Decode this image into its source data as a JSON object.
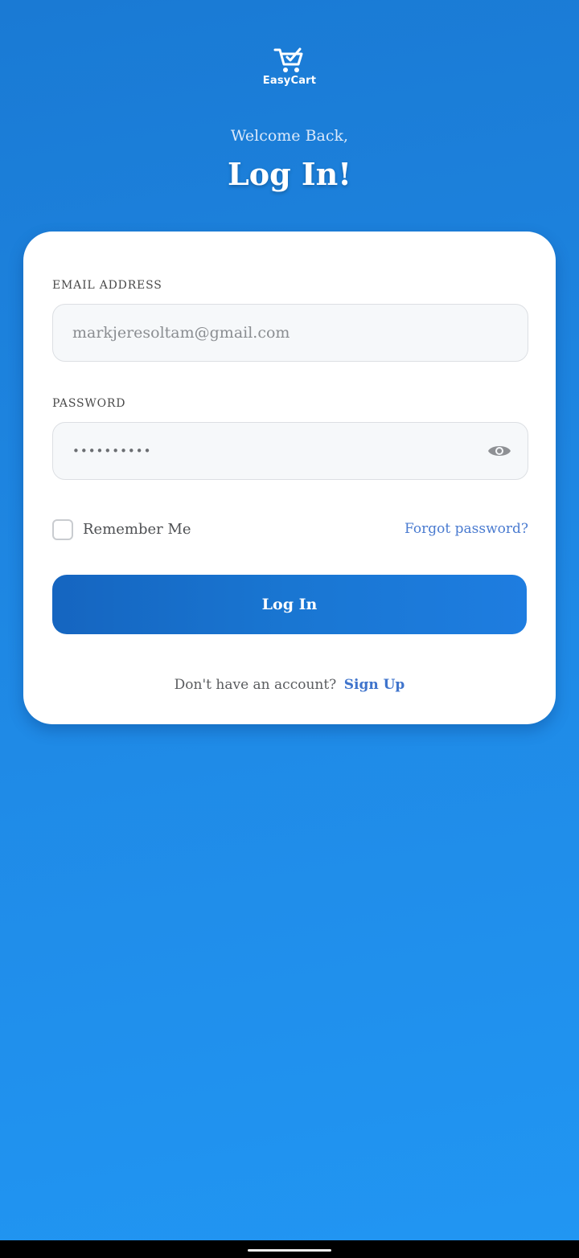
{
  "app": {
    "name": "EasyCart",
    "logo_icon": "cart-check-icon",
    "brand_color": "#1e88e5"
  },
  "header": {
    "greeting": "Welcome Back,",
    "title": "Log In!"
  },
  "form": {
    "email": {
      "label": "EMAIL ADDRESS",
      "placeholder": "markjeresoltam@gmail.com",
      "value": ""
    },
    "password": {
      "label": "PASSWORD",
      "masked_value": "••••••••••",
      "toggle_icon": "eye-icon"
    },
    "remember": {
      "label": "Remember Me",
      "checked": false
    },
    "forgot_label": "Forgot password?",
    "submit_label": "Log In"
  },
  "signup": {
    "prompt": "Don't have an account?",
    "link_label": "Sign Up"
  },
  "colors": {
    "background_top": "#1a7ad4",
    "background_bottom": "#2196f3",
    "button": "#1976d2",
    "link": "#4a7bd0"
  }
}
